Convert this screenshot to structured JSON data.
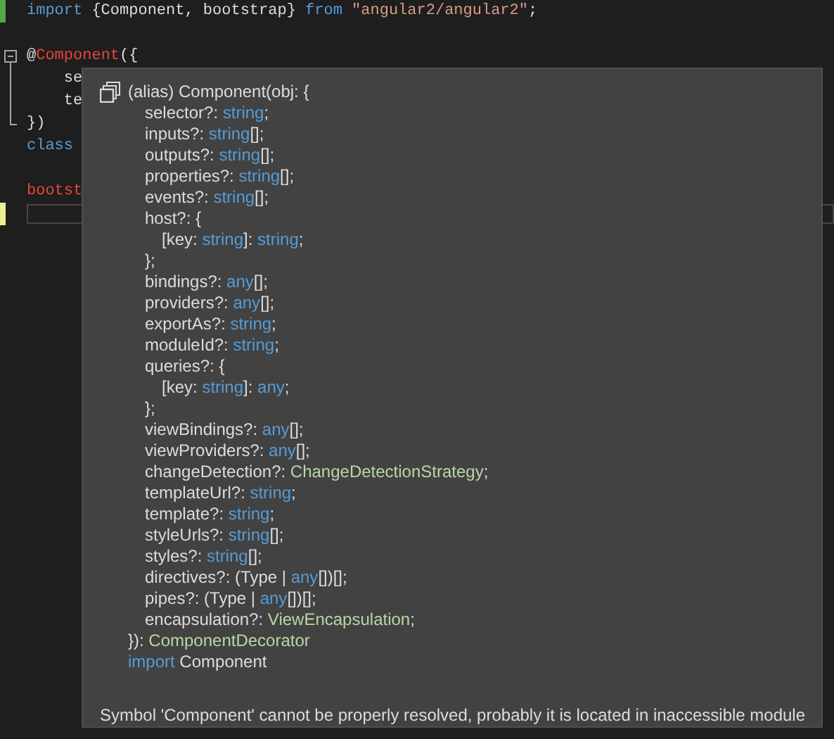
{
  "editor": {
    "lines": [
      {
        "kind": "code",
        "color": "#57a64a",
        "current": false,
        "tokens": [
          {
            "kind": "keyword",
            "text": "import"
          },
          {
            "kind": "plain",
            "text": " {Component, bootstrap} "
          },
          {
            "kind": "keyword",
            "text": "from"
          },
          {
            "kind": "string",
            "text": " \"angular2/angular2\""
          },
          {
            "kind": "plain",
            "text": ";"
          }
        ]
      },
      {
        "kind": "blank",
        "current": false
      },
      {
        "kind": "fold-start",
        "current": false,
        "tokens": [
          {
            "kind": "plain",
            "text": "@"
          },
          {
            "kind": "error",
            "text": "Component"
          },
          {
            "kind": "plain",
            "text": "({"
          }
        ]
      },
      {
        "kind": "fold-inner",
        "current": false,
        "tokens": [
          {
            "kind": "plain",
            "text": "    se"
          }
        ]
      },
      {
        "kind": "fold-inner",
        "current": false,
        "tokens": [
          {
            "kind": "plain",
            "text": "    te"
          }
        ]
      },
      {
        "kind": "fold-end",
        "current": false,
        "tokens": [
          {
            "kind": "plain",
            "text": "})"
          }
        ]
      },
      {
        "kind": "code",
        "current": false,
        "tokens": [
          {
            "kind": "keyword",
            "text": "class"
          }
        ]
      },
      {
        "kind": "blank",
        "current": false
      },
      {
        "kind": "code",
        "current": false,
        "tokens": [
          {
            "kind": "error",
            "text": "bootst"
          }
        ]
      },
      {
        "kind": "blank",
        "color": "#efef91",
        "current": true
      }
    ]
  },
  "tooltip": {
    "header": "(alias) Component(obj: {",
    "members": [
      {
        "tokens": [
          {
            "kind": "plain",
            "text": "selector?: "
          },
          {
            "kind": "type",
            "text": "string"
          },
          {
            "kind": "plain",
            "text": ";"
          }
        ]
      },
      {
        "tokens": [
          {
            "kind": "plain",
            "text": "inputs?: "
          },
          {
            "kind": "type",
            "text": "string"
          },
          {
            "kind": "plain",
            "text": "[];"
          }
        ]
      },
      {
        "tokens": [
          {
            "kind": "plain",
            "text": "outputs?: "
          },
          {
            "kind": "type",
            "text": "string"
          },
          {
            "kind": "plain",
            "text": "[];"
          }
        ]
      },
      {
        "tokens": [
          {
            "kind": "plain",
            "text": "properties?: "
          },
          {
            "kind": "type",
            "text": "string"
          },
          {
            "kind": "plain",
            "text": "[];"
          }
        ]
      },
      {
        "tokens": [
          {
            "kind": "plain",
            "text": "events?: "
          },
          {
            "kind": "type",
            "text": "string"
          },
          {
            "kind": "plain",
            "text": "[];"
          }
        ]
      },
      {
        "tokens": [
          {
            "kind": "plain",
            "text": "host?: {"
          }
        ],
        "children": [
          {
            "tokens": [
              {
                "kind": "plain",
                "text": "[key: "
              },
              {
                "kind": "type",
                "text": "string"
              },
              {
                "kind": "plain",
                "text": "]: "
              },
              {
                "kind": "type",
                "text": "string"
              },
              {
                "kind": "plain",
                "text": ";"
              }
            ]
          }
        ],
        "closing": "};"
      },
      {
        "tokens": [
          {
            "kind": "plain",
            "text": "bindings?: "
          },
          {
            "kind": "type",
            "text": "any"
          },
          {
            "kind": "plain",
            "text": "[];"
          }
        ]
      },
      {
        "tokens": [
          {
            "kind": "plain",
            "text": "providers?: "
          },
          {
            "kind": "type",
            "text": "any"
          },
          {
            "kind": "plain",
            "text": "[];"
          }
        ]
      },
      {
        "tokens": [
          {
            "kind": "plain",
            "text": "exportAs?: "
          },
          {
            "kind": "type",
            "text": "string"
          },
          {
            "kind": "plain",
            "text": ";"
          }
        ]
      },
      {
        "tokens": [
          {
            "kind": "plain",
            "text": "moduleId?: "
          },
          {
            "kind": "type",
            "text": "string"
          },
          {
            "kind": "plain",
            "text": ";"
          }
        ]
      },
      {
        "tokens": [
          {
            "kind": "plain",
            "text": "queries?: {"
          }
        ],
        "children": [
          {
            "tokens": [
              {
                "kind": "plain",
                "text": "[key: "
              },
              {
                "kind": "type",
                "text": "string"
              },
              {
                "kind": "plain",
                "text": "]: "
              },
              {
                "kind": "type",
                "text": "any"
              },
              {
                "kind": "plain",
                "text": ";"
              }
            ]
          }
        ],
        "closing": "};"
      },
      {
        "tokens": [
          {
            "kind": "plain",
            "text": "viewBindings?: "
          },
          {
            "kind": "type",
            "text": "any"
          },
          {
            "kind": "plain",
            "text": "[];"
          }
        ]
      },
      {
        "tokens": [
          {
            "kind": "plain",
            "text": "viewProviders?: "
          },
          {
            "kind": "type",
            "text": "any"
          },
          {
            "kind": "plain",
            "text": "[];"
          }
        ]
      },
      {
        "tokens": [
          {
            "kind": "plain",
            "text": "changeDetection?: "
          },
          {
            "kind": "class",
            "text": "ChangeDetectionStrategy"
          },
          {
            "kind": "plain",
            "text": ";"
          }
        ]
      },
      {
        "tokens": [
          {
            "kind": "plain",
            "text": "templateUrl?: "
          },
          {
            "kind": "type",
            "text": "string"
          },
          {
            "kind": "plain",
            "text": ";"
          }
        ]
      },
      {
        "tokens": [
          {
            "kind": "plain",
            "text": "template?: "
          },
          {
            "kind": "type",
            "text": "string"
          },
          {
            "kind": "plain",
            "text": ";"
          }
        ]
      },
      {
        "tokens": [
          {
            "kind": "plain",
            "text": "styleUrls?: "
          },
          {
            "kind": "type",
            "text": "string"
          },
          {
            "kind": "plain",
            "text": "[];"
          }
        ]
      },
      {
        "tokens": [
          {
            "kind": "plain",
            "text": "styles?: "
          },
          {
            "kind": "type",
            "text": "string"
          },
          {
            "kind": "plain",
            "text": "[];"
          }
        ]
      },
      {
        "tokens": [
          {
            "kind": "plain",
            "text": "directives?: (Type | "
          },
          {
            "kind": "type",
            "text": "any"
          },
          {
            "kind": "plain",
            "text": "[])[];"
          }
        ]
      },
      {
        "tokens": [
          {
            "kind": "plain",
            "text": "pipes?: (Type | "
          },
          {
            "kind": "type",
            "text": "any"
          },
          {
            "kind": "plain",
            "text": "[])[];"
          }
        ]
      },
      {
        "tokens": [
          {
            "kind": "plain",
            "text": "encapsulation?: "
          },
          {
            "kind": "class",
            "text": "ViewEncapsulation"
          },
          {
            "kind": "plain",
            "text": ";"
          }
        ]
      }
    ],
    "footer": [
      {
        "kind": "plain",
        "text": "}): "
      },
      {
        "kind": "class",
        "text": "ComponentDecorator"
      }
    ],
    "import_line": [
      {
        "kind": "type",
        "text": "import"
      },
      {
        "kind": "plain",
        "text": " Component"
      }
    ],
    "message": "Symbol 'Component' cannot be properly resolved, probably it is located in inaccessible module"
  }
}
